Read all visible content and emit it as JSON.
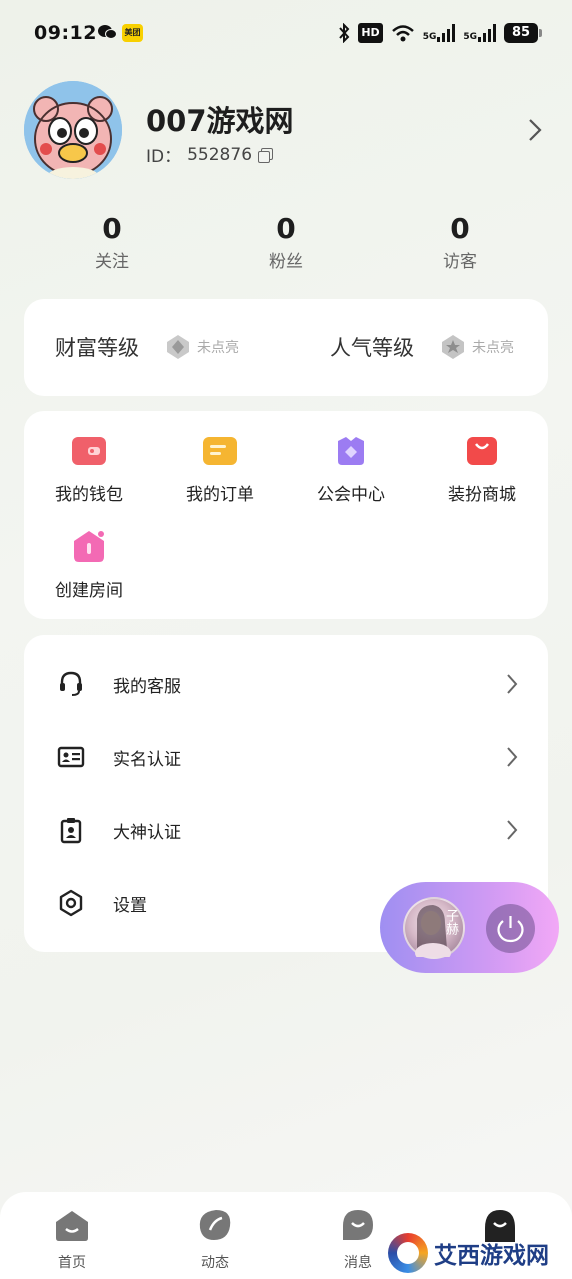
{
  "status_bar": {
    "time": "09:12",
    "meituan_label": "美团",
    "hd_label": "HD",
    "signal_labels": [
      "5G",
      "5G"
    ],
    "battery": "85",
    "icons": [
      "wechat-icon",
      "meituan-icon",
      "bluetooth-icon",
      "wifi-icon",
      "signal-icon"
    ]
  },
  "profile": {
    "username": "007游戏网",
    "id_label": "ID：",
    "id_value": "552876"
  },
  "stats": [
    {
      "value": "0",
      "label": "关注"
    },
    {
      "value": "0",
      "label": "粉丝"
    },
    {
      "value": "0",
      "label": "访客"
    }
  ],
  "levels": [
    {
      "name": "财富等级",
      "status": "未点亮"
    },
    {
      "name": "人气等级",
      "status": "未点亮"
    }
  ],
  "shortcuts": [
    {
      "label": "我的钱包",
      "icon": "wallet-icon",
      "color": "#f0606a"
    },
    {
      "label": "我的订单",
      "icon": "order-icon",
      "color": "#f5b531"
    },
    {
      "label": "公会中心",
      "icon": "guild-icon",
      "color": "#9c7cf2"
    },
    {
      "label": "装扮商城",
      "icon": "shop-bag-icon",
      "color": "#f24a4a"
    },
    {
      "label": "创建房间",
      "icon": "create-room-icon",
      "color": "#f36ab4"
    }
  ],
  "menu": [
    {
      "label": "我的客服",
      "icon": "headset-icon"
    },
    {
      "label": "实名认证",
      "icon": "id-card-icon"
    },
    {
      "label": "大神认证",
      "icon": "badge-card-icon"
    },
    {
      "label": "设置",
      "icon": "gear-icon"
    }
  ],
  "bottom_nav": [
    {
      "label": "首页",
      "icon": "home-icon"
    },
    {
      "label": "动态",
      "icon": "feed-icon"
    },
    {
      "label": "消息",
      "icon": "message-icon"
    },
    {
      "label": "",
      "icon": "profile-icon"
    }
  ],
  "watermark": {
    "text": "艾西游戏网",
    "float_avatar_text": "子赫"
  },
  "colors": {
    "background": "#f1f3ee",
    "card": "#ffffff",
    "float_player_start": "#9f8ff2",
    "float_player_end": "#f2a8f6",
    "watermark_text": "#1f3e86"
  }
}
